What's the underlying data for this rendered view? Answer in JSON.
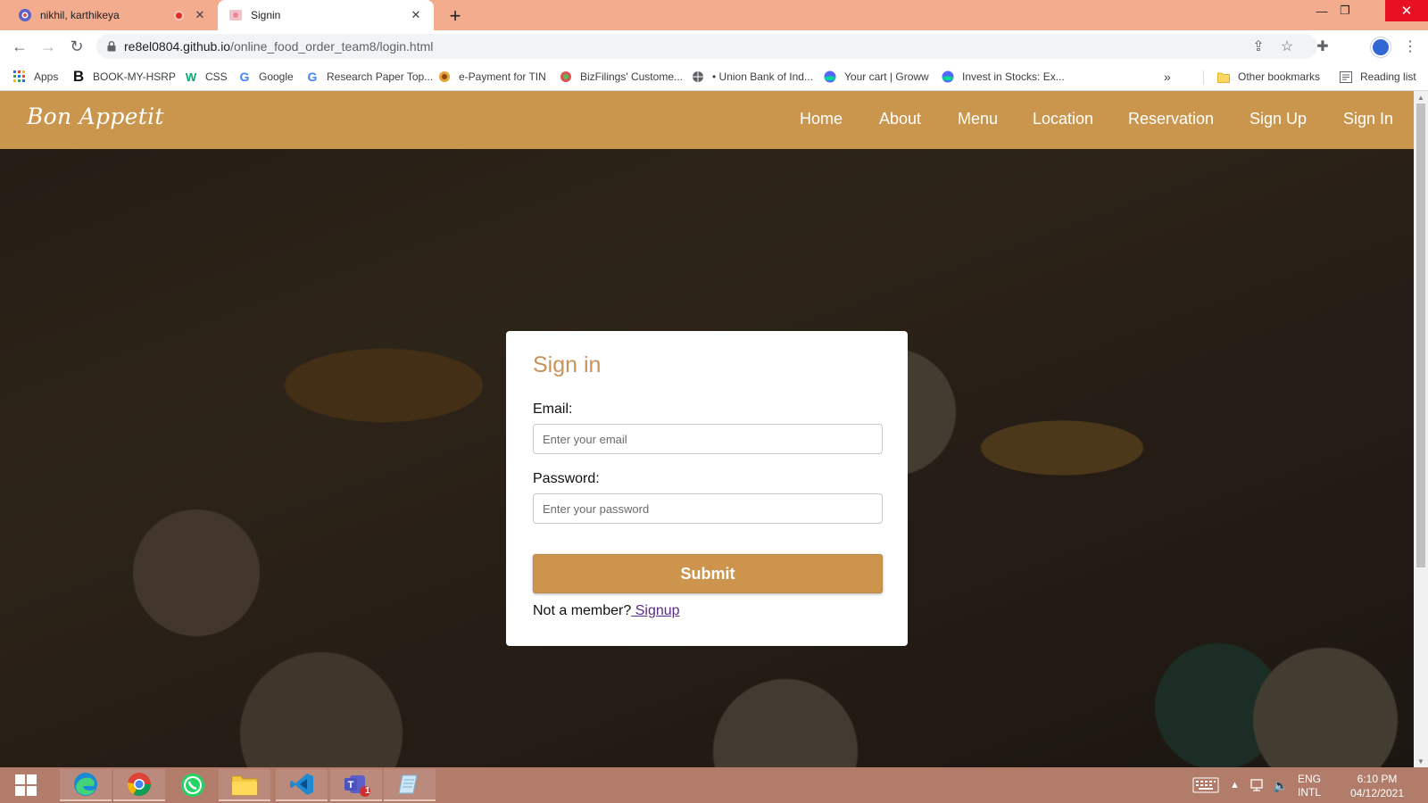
{
  "browser": {
    "tabs": [
      {
        "title": "nikhil, karthikeya",
        "recording": true,
        "active": false
      },
      {
        "title": "Signin",
        "active": true
      }
    ],
    "new_tab_label": "+",
    "url_host": "re8el0804.github.io",
    "url_path": "/online_food_order_team8/login.html",
    "bookmarks": [
      {
        "label": "Apps",
        "icon": "apps-grid-icon"
      },
      {
        "label": "BOOK-MY-HSRP",
        "icon": "b-logo-icon"
      },
      {
        "label": "CSS",
        "icon": "w3schools-icon"
      },
      {
        "label": "Google",
        "icon": "google-icon"
      },
      {
        "label": "Research Paper Top...",
        "icon": "google-icon"
      },
      {
        "label": "e-Payment for TIN",
        "icon": "tin-icon"
      },
      {
        "label": "BizFilings' Custome...",
        "icon": "bizfilings-icon"
      },
      {
        "label": "• Union Bank of Ind...",
        "icon": "globe-icon"
      },
      {
        "label": "Your cart | Groww",
        "icon": "groww-icon"
      },
      {
        "label": "Invest in Stocks: Ex...",
        "icon": "groww-icon"
      }
    ],
    "overflow_label": "»",
    "other_bookmarks": "Other bookmarks",
    "reading_list": "Reading list"
  },
  "site": {
    "brand": "Bon Appetit",
    "nav": [
      "Home",
      "About",
      "Menu",
      "Location",
      "Reservation",
      "Sign Up",
      "Sign In"
    ],
    "colors": {
      "accent": "#ca964d",
      "title": "#c8925a",
      "link": "#5b2a86"
    }
  },
  "signin": {
    "title": "Sign in",
    "email_label": "Email:",
    "email_placeholder": "Enter your email",
    "email_value": "",
    "password_label": "Password:",
    "password_placeholder": "Enter your password",
    "password_value": "",
    "submit_label": "Submit",
    "member_prompt": "Not a member?",
    "signup_link": " Signup"
  },
  "taskbar": {
    "apps": [
      "windows-start-icon",
      "edge-icon",
      "chrome-icon",
      "whatsapp-icon",
      "file-explorer-icon",
      "vscode-icon",
      "teams-icon",
      "notepad-icon"
    ],
    "teams_badge": "1",
    "lang_top": "ENG",
    "lang_bottom": "INTL",
    "time": "6:10 PM",
    "date": "04/12/2021"
  }
}
